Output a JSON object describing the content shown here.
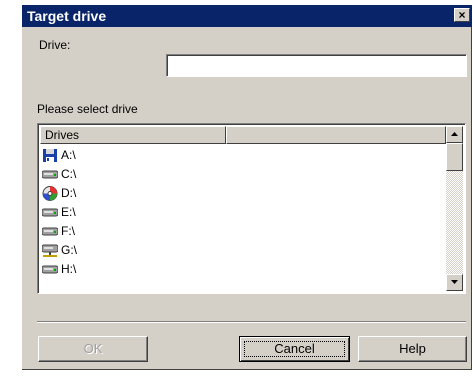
{
  "window": {
    "title": "Target drive",
    "close_label": "×"
  },
  "drive": {
    "label": "Drive:",
    "value": ""
  },
  "select_label": "Please select drive",
  "list": {
    "columns": [
      "Drives",
      ""
    ],
    "items": [
      {
        "label": "A:\\",
        "icon": "floppy-drive-icon"
      },
      {
        "label": "C:\\",
        "icon": "hard-drive-icon"
      },
      {
        "label": "D:\\",
        "icon": "cd-drive-icon"
      },
      {
        "label": "E:\\",
        "icon": "hard-drive-icon"
      },
      {
        "label": "F:\\",
        "icon": "hard-drive-icon"
      },
      {
        "label": "G:\\",
        "icon": "network-drive-icon"
      },
      {
        "label": "H:\\",
        "icon": "hard-drive-icon"
      }
    ]
  },
  "buttons": {
    "ok": "OK",
    "cancel": "Cancel",
    "help": "Help"
  },
  "colors": {
    "titlebar": "#0a246a",
    "face": "#d4d0c8"
  }
}
